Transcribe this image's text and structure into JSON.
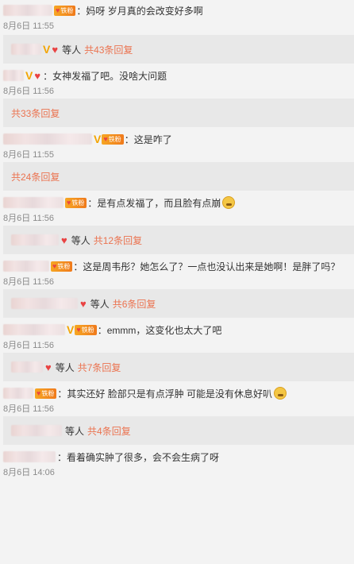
{
  "badge_text": "铁粉",
  "who_suffix": "等人",
  "comments": [
    {
      "text": "妈呀 岁月真的会改变好多啊",
      "time": "8月6日 11:55"
    },
    {
      "text": "女神发福了吧。没啥大问题",
      "time": "8月6日 11:56"
    },
    {
      "text": "这是咋了",
      "time": "8月6日 11:55"
    },
    {
      "text": "是有点发福了，而且脸有点崩",
      "time": "8月6日 11:56"
    },
    {
      "text": "这是周韦彤？她怎么了？一点也没认出来是她啊！是胖了吗？",
      "time": "8月6日 11:56"
    },
    {
      "text": "emmm，这变化也太大了吧",
      "time": "8月6日 11:56"
    },
    {
      "text": "其实还好 脸部只是有点浮肿 可能是没有休息好叭",
      "time": "8月6日 11:56"
    },
    {
      "text": "看着确实肿了很多，会不会生病了呀",
      "time": "8月6日 14:06"
    }
  ],
  "replies": [
    {
      "count": "共43条回复"
    },
    {
      "count": "共33条回复"
    },
    {
      "count": "共24条回复"
    },
    {
      "count": "共12条回复"
    },
    {
      "count": "共6条回复"
    },
    {
      "count": "共7条回复"
    },
    {
      "count": "共4条回复"
    }
  ],
  "colors": {
    "link": "#eb7350",
    "badge": "#f39c23",
    "background": "#f3f3f3",
    "reply_background": "#e8e8e8"
  }
}
